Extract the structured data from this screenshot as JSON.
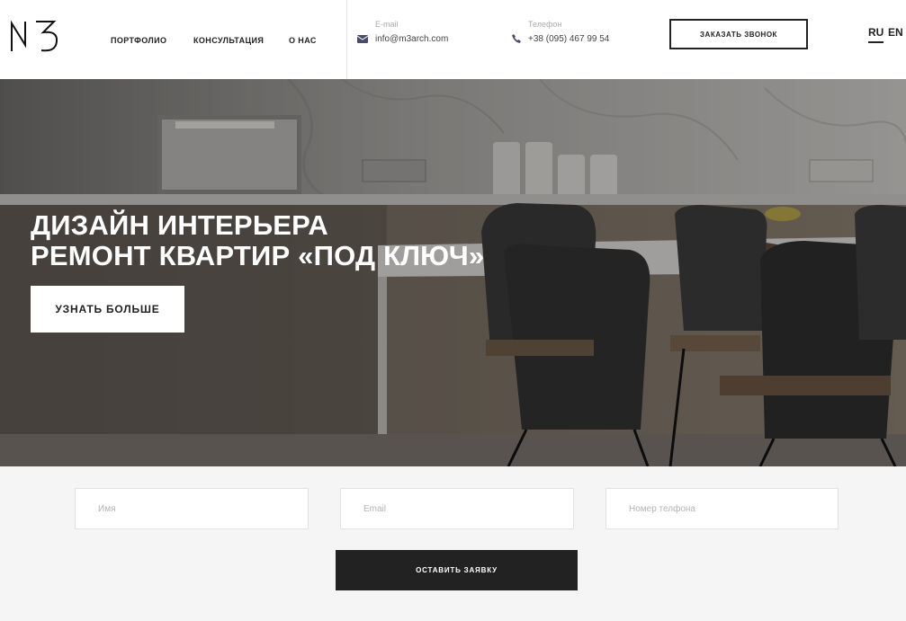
{
  "header": {
    "logo_icon": "m3-logo-icon",
    "nav": [
      {
        "label": "ПОРТФОЛИО"
      },
      {
        "label": "КОНСУЛЬТАЦИЯ"
      },
      {
        "label": "О НАС"
      }
    ],
    "email": {
      "label": "E-mail",
      "value": "info@m3arch.com",
      "icon": "envelope-icon"
    },
    "phone": {
      "label": "Телефон",
      "value": "+38 (095) 467 99 54",
      "icon": "phone-icon"
    },
    "callback_label": "ЗАКАЗАТЬ ЗВОНОК",
    "languages": [
      {
        "label": "RU",
        "active": true
      },
      {
        "label": "EN",
        "active": false
      }
    ]
  },
  "hero": {
    "title_line1": "ДИЗАЙН ИНТЕРЬЕРА",
    "title_line2": "РЕМОНТ КВАРТИР «ПОД КЛЮЧ»",
    "button_label": "УЗНАТЬ БОЛЬШЕ"
  },
  "form": {
    "name_placeholder": "Имя",
    "email_placeholder": "Email",
    "phone_placeholder": "Номер телфона",
    "submit_label": "ОСТАВИТЬ ЗАЯВКУ"
  },
  "colors": {
    "text_dark": "#222222",
    "accent_icon": "#4a4a6a",
    "form_bg": "#f5f5f5"
  }
}
